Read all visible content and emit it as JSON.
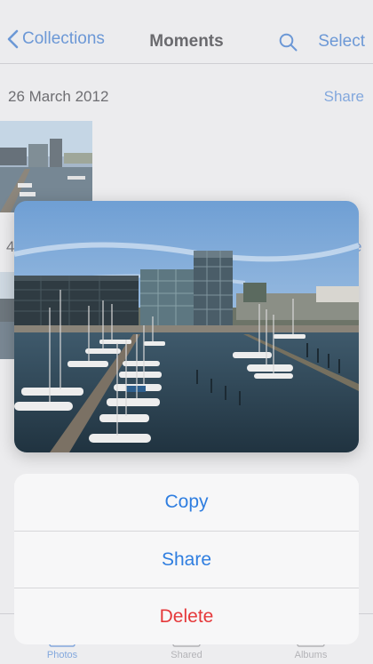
{
  "navbar": {
    "back_label": "Collections",
    "title": "Moments",
    "select_label": "Select"
  },
  "moment": {
    "date": "26 March 2012",
    "share_label": "Share"
  },
  "partial": {
    "left_char": "4",
    "right_char": "e"
  },
  "tabs": [
    {
      "label": "Photos",
      "icon": "photos-icon",
      "active": true
    },
    {
      "label": "Shared",
      "icon": "shared-icon",
      "active": false
    },
    {
      "label": "Albums",
      "icon": "albums-icon",
      "active": false
    }
  ],
  "action_sheet": {
    "copy_label": "Copy",
    "share_label": "Share",
    "delete_label": "Delete"
  },
  "colors": {
    "accent": "#2f7ee0",
    "destructive": "#e5393b"
  }
}
